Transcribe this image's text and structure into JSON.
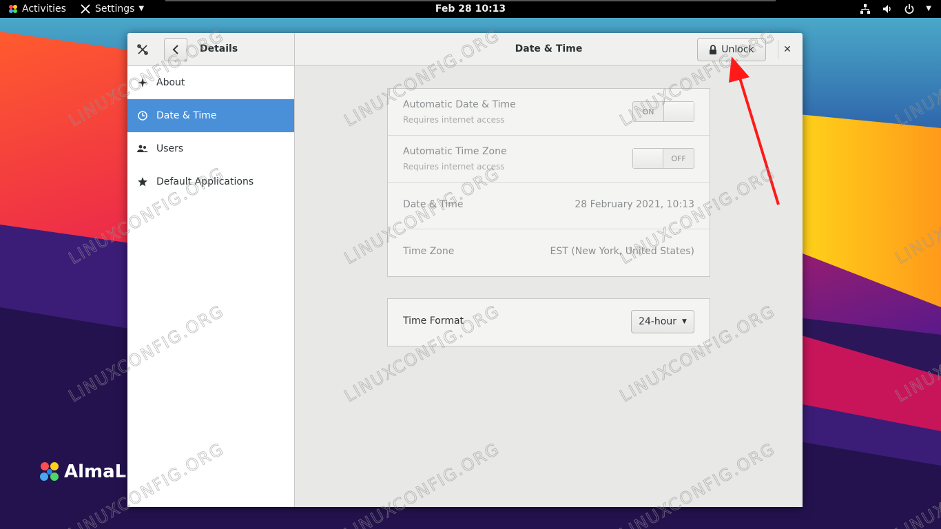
{
  "topbar": {
    "activities": "Activities",
    "app_menu": "Settings",
    "clock": "Feb 28  10:13"
  },
  "window": {
    "sidebar_title": "Details",
    "title": "Date & Time",
    "unlock_label": "Unlock",
    "close_glyph": "✕"
  },
  "sidebar": {
    "items": [
      {
        "label": "About",
        "icon": "sparkle-icon"
      },
      {
        "label": "Date & Time",
        "icon": "clock-icon",
        "active": true
      },
      {
        "label": "Users",
        "icon": "users-icon"
      },
      {
        "label": "Default Applications",
        "icon": "star-icon"
      }
    ]
  },
  "datetime": {
    "auto_datetime": {
      "title": "Automatic Date & Time",
      "subtitle": "Requires internet access",
      "state": "ON"
    },
    "auto_timezone": {
      "title": "Automatic Time Zone",
      "subtitle": "Requires internet access",
      "state": "OFF"
    },
    "date_time": {
      "title": "Date & Time",
      "value": "28 February 2021, 10:13"
    },
    "time_zone": {
      "title": "Time Zone",
      "value": "EST (New York, United States)"
    },
    "time_format": {
      "title": "Time Format",
      "value": "24-hour"
    }
  },
  "desktop": {
    "logo_text": "AlmaLin",
    "watermark": "LINUXCONFIG.ORG"
  },
  "colors": {
    "accent": "#4a90d9",
    "annotation_arrow": "#ff1a1a"
  }
}
